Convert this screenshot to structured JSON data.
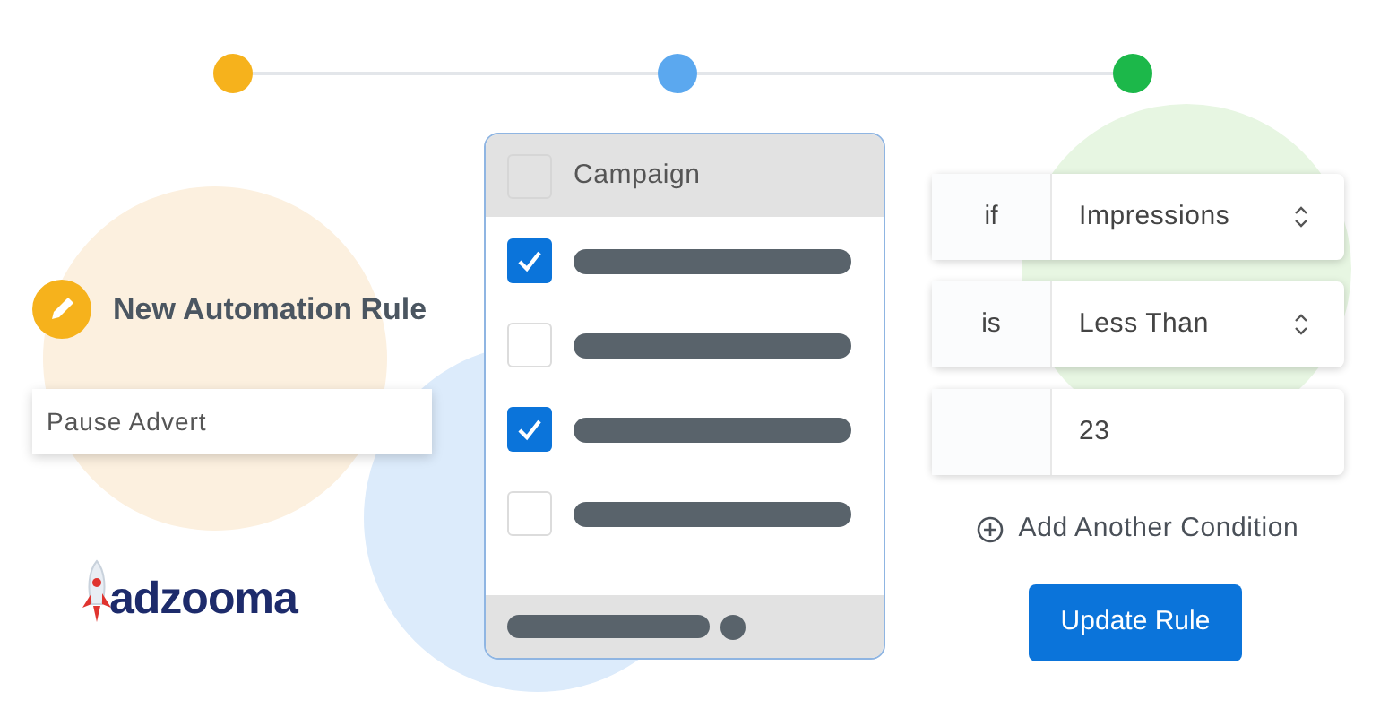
{
  "steps": [
    {
      "color": "#f6b21c"
    },
    {
      "color": "#5ba8ef"
    },
    {
      "color": "#1cb84a"
    }
  ],
  "rule": {
    "title": "New Automation Rule",
    "value": "Pause Advert"
  },
  "logo": {
    "text": "adzooma"
  },
  "campaign": {
    "header": "Campaign",
    "header_checked": false,
    "rows": [
      {
        "checked": true
      },
      {
        "checked": false
      },
      {
        "checked": true
      },
      {
        "checked": false
      }
    ]
  },
  "conditions": [
    {
      "kind": "select",
      "label": "if",
      "value": "Impressions"
    },
    {
      "kind": "select",
      "label": "is",
      "value": "Less Than"
    },
    {
      "kind": "input",
      "value": "23"
    }
  ],
  "add_condition": "Add Another Condition",
  "button": "Update Rule"
}
